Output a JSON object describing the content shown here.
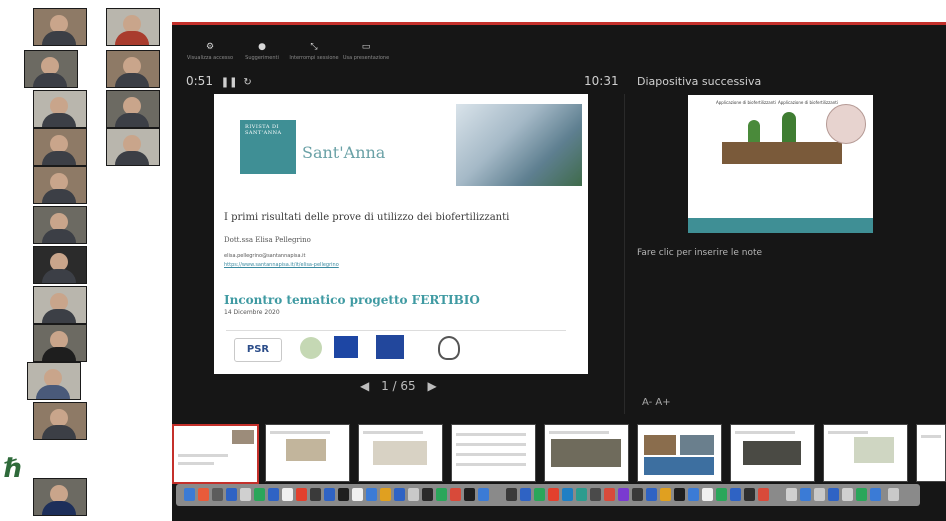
{
  "presenter": {
    "toolbar": [
      {
        "label": "Visualizza accesso",
        "icon": "gear-icon"
      },
      {
        "label": "Suggerimenti",
        "icon": "lightbulb-icon"
      },
      {
        "label": "Interrompi sessione",
        "icon": "stop-icon"
      },
      {
        "label": "Usa presentazione",
        "icon": "present-icon"
      }
    ],
    "elapsed": "0:51",
    "clock": "10:31",
    "page_indicator": "1 / 65",
    "next_slide_label": "Diapositiva successiva",
    "notes_placeholder": "Fare clic per inserire le note",
    "font_controls": "A- A+"
  },
  "slide": {
    "logo_text": "RIVISTA DI SANT'ANNA",
    "institution": "Sant'Anna",
    "title": "I primi risultati delle prove di utilizzo dei biofertilizzanti",
    "author": "Dott.ssa Elisa Pellegrino",
    "email": "elisa.pellegrino@santannapisa.it",
    "link": "https://www.santannapisa.it/it/elisa-pellegrino",
    "event": "Incontro tematico progetto FERTIBIO",
    "date": "14 Dicembre 2020",
    "footer_psr": "PSR"
  },
  "next_slide": {
    "label_left": "Applicazione di biofertilizzanti",
    "label_right": "Applicazione di biofertilizzanti"
  },
  "participants": {
    "count": 20
  },
  "colors": {
    "accent": "#c4302b",
    "teal": "#3f8f95",
    "panel": "#161616"
  }
}
